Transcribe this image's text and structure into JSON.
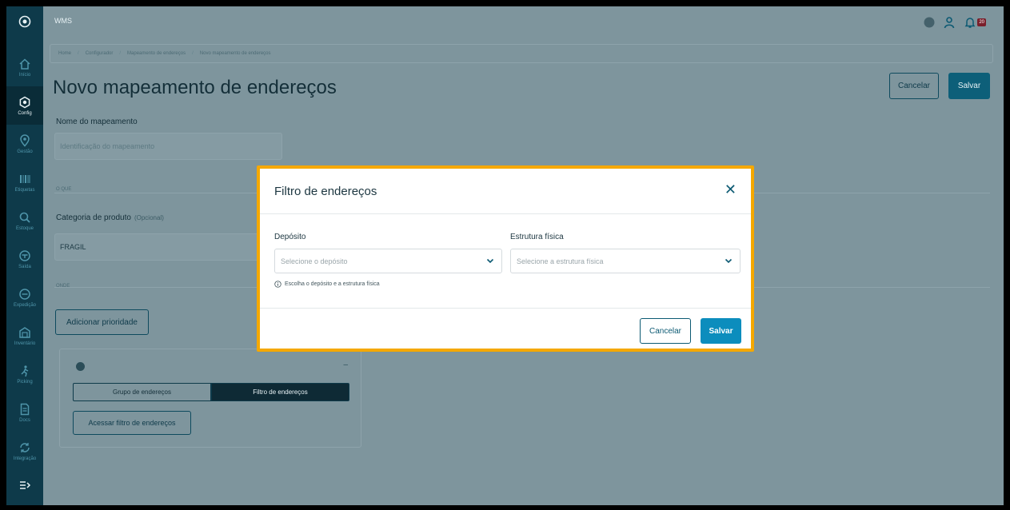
{
  "app": {
    "name": "WMS"
  },
  "sidebar": {
    "items": [
      {
        "label": "Início",
        "icon": "home-icon"
      },
      {
        "label": "Config",
        "icon": "settings-icon",
        "active": true
      },
      {
        "label": "Gestão",
        "icon": "location-icon"
      },
      {
        "label": "Etiquetas",
        "icon": "barcode-icon"
      },
      {
        "label": "Estoque",
        "icon": "search-icon"
      },
      {
        "label": "Saída",
        "icon": "box-out-icon"
      },
      {
        "label": "Expedição",
        "icon": "box-icon"
      },
      {
        "label": "Inventário",
        "icon": "warehouse-icon"
      },
      {
        "label": "Picking",
        "icon": "picking-icon"
      },
      {
        "label": "Docs",
        "icon": "document-icon"
      },
      {
        "label": "Integração",
        "icon": "sync-icon"
      }
    ],
    "expand_icon": "expand-menu-icon"
  },
  "breadcrumb": [
    "Home",
    "Configurador",
    "Mapeamento de endereços",
    "Novo mapeamento de endereços"
  ],
  "page": {
    "title": "Novo mapeamento de endereços",
    "cancel_label": "Cancelar",
    "save_label": "Salvar",
    "name_label": "Nome do mapeamento",
    "name_placeholder": "Identificação do mapeamento",
    "section_what": "O QUE",
    "category_label": "Categoria de produto",
    "category_optional": "(Opcional)",
    "category_value": "FRAGIL",
    "section_where": "ONDE",
    "add_priority_label": "Adicionar prioridade",
    "segment_group": "Grupo de endereços",
    "segment_filter": "Filtro de endereços",
    "access_filter_label": "Acessar filtro de endereços",
    "notification_count": "20"
  },
  "modal": {
    "title": "Filtro de endereços",
    "deposit_label": "Depósito",
    "deposit_placeholder": "Selecione o depósito",
    "structure_label": "Estrutura física",
    "structure_placeholder": "Selecione a estrutura física",
    "hint": "Escolha o depósito e a estrutura física",
    "cancel_label": "Cancelar",
    "save_label": "Salvar",
    "highlight_color": "#f5a800"
  }
}
